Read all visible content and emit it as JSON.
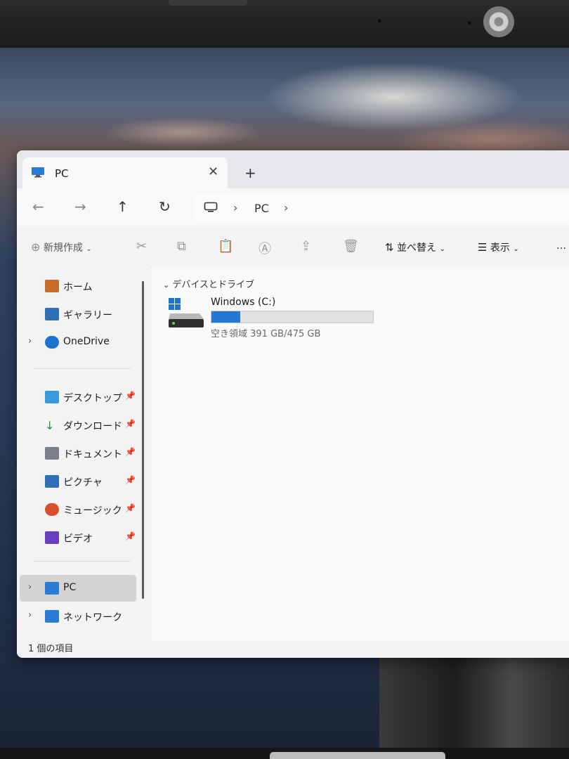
{
  "window": {
    "tab_title": "PC",
    "tab_close": "✕",
    "new_tab": "+"
  },
  "nav": {
    "back": "←",
    "forward": "→",
    "up": "↑",
    "refresh": "↻"
  },
  "address": {
    "sep1": "›",
    "location": "PC",
    "sep2": "›"
  },
  "toolbar": {
    "new_label": "新規作成",
    "sort_label": "並べ替え",
    "view_label": "表示",
    "more": "…",
    "icons": [
      "cut-icon",
      "copy-icon",
      "paste-icon",
      "rename-icon",
      "share-icon",
      "delete-icon"
    ]
  },
  "sidebar": {
    "top": [
      {
        "label": "ホーム",
        "icon": "home-icon",
        "color": "#c96d2d"
      },
      {
        "label": "ギャラリー",
        "icon": "gallery-icon",
        "color": "#2f6fb5"
      },
      {
        "label": "OneDrive",
        "icon": "cloud-icon",
        "color": "#1f73d0"
      }
    ],
    "pinned": [
      {
        "label": "デスクトップ",
        "icon": "desktop-icon",
        "color": "#3a9ad9"
      },
      {
        "label": "ダウンロード",
        "icon": "download-icon",
        "color": "#2b8a3e"
      },
      {
        "label": "ドキュメント",
        "icon": "documents-icon",
        "color": "#7a7f8a"
      },
      {
        "label": "ピクチャ",
        "icon": "pictures-icon",
        "color": "#2f6fb5"
      },
      {
        "label": "ミュージック",
        "icon": "music-icon",
        "color": "#d9502e"
      },
      {
        "label": "ビデオ",
        "icon": "videos-icon",
        "color": "#6a3fbf"
      }
    ],
    "bottom": [
      {
        "label": "PC",
        "icon": "pc-icon",
        "color": "#2a7bd4"
      },
      {
        "label": "ネットワーク",
        "icon": "network-icon",
        "color": "#2a7bd4"
      }
    ]
  },
  "content": {
    "group_header": "デバイスとドライブ",
    "drive": {
      "name": "Windows (C:)",
      "free_text": "空き領域 391 GB/475 GB",
      "used_fraction": 0.18,
      "bar_color": "#2478d1"
    }
  },
  "status": {
    "text": "1 個の項目"
  }
}
